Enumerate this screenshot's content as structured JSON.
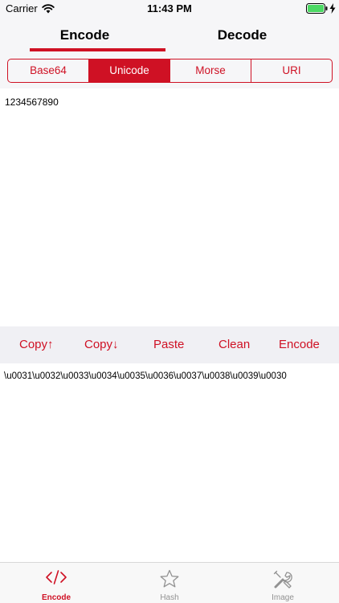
{
  "status_bar": {
    "carrier": "Carrier",
    "time": "11:43 PM"
  },
  "top_tabs": [
    {
      "label": "Encode",
      "active": true
    },
    {
      "label": "Decode",
      "active": false
    }
  ],
  "segments": [
    {
      "label": "Base64",
      "active": false
    },
    {
      "label": "Unicode",
      "active": true
    },
    {
      "label": "Morse",
      "active": false
    },
    {
      "label": "URI",
      "active": false
    }
  ],
  "input": {
    "value": "1234567890"
  },
  "actions": {
    "copy_up": "Copy↑",
    "copy_down": "Copy↓",
    "paste": "Paste",
    "clean": "Clean",
    "encode": "Encode"
  },
  "output": {
    "value": "\\u0031\\u0032\\u0033\\u0034\\u0035\\u0036\\u0037\\u0038\\u0039\\u0030"
  },
  "bottom_tabs": [
    {
      "label": "Encode",
      "icon": "code-icon",
      "active": true
    },
    {
      "label": "Hash",
      "icon": "star-icon",
      "active": false
    },
    {
      "label": "Image",
      "icon": "tools-icon",
      "active": false
    }
  ],
  "colors": {
    "accent": "#cf1124",
    "bar_background": "#f6f6f8",
    "action_bar_background": "#f0f0f4",
    "inactive_tab": "#929292"
  }
}
